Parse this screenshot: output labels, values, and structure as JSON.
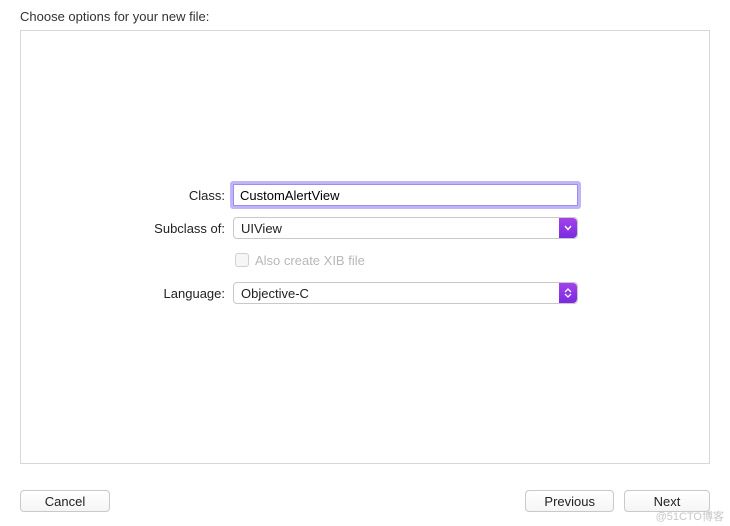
{
  "header": {
    "title": "Choose options for your new file:"
  },
  "form": {
    "class_label": "Class:",
    "class_value": "CustomAlertView",
    "subclass_label": "Subclass of:",
    "subclass_value": "UIView",
    "xib_label": "Also create XIB file",
    "xib_checked": false,
    "xib_enabled": false,
    "language_label": "Language:",
    "language_value": "Objective-C"
  },
  "buttons": {
    "cancel": "Cancel",
    "previous": "Previous",
    "next": "Next"
  },
  "watermark": "@51CTO博客"
}
